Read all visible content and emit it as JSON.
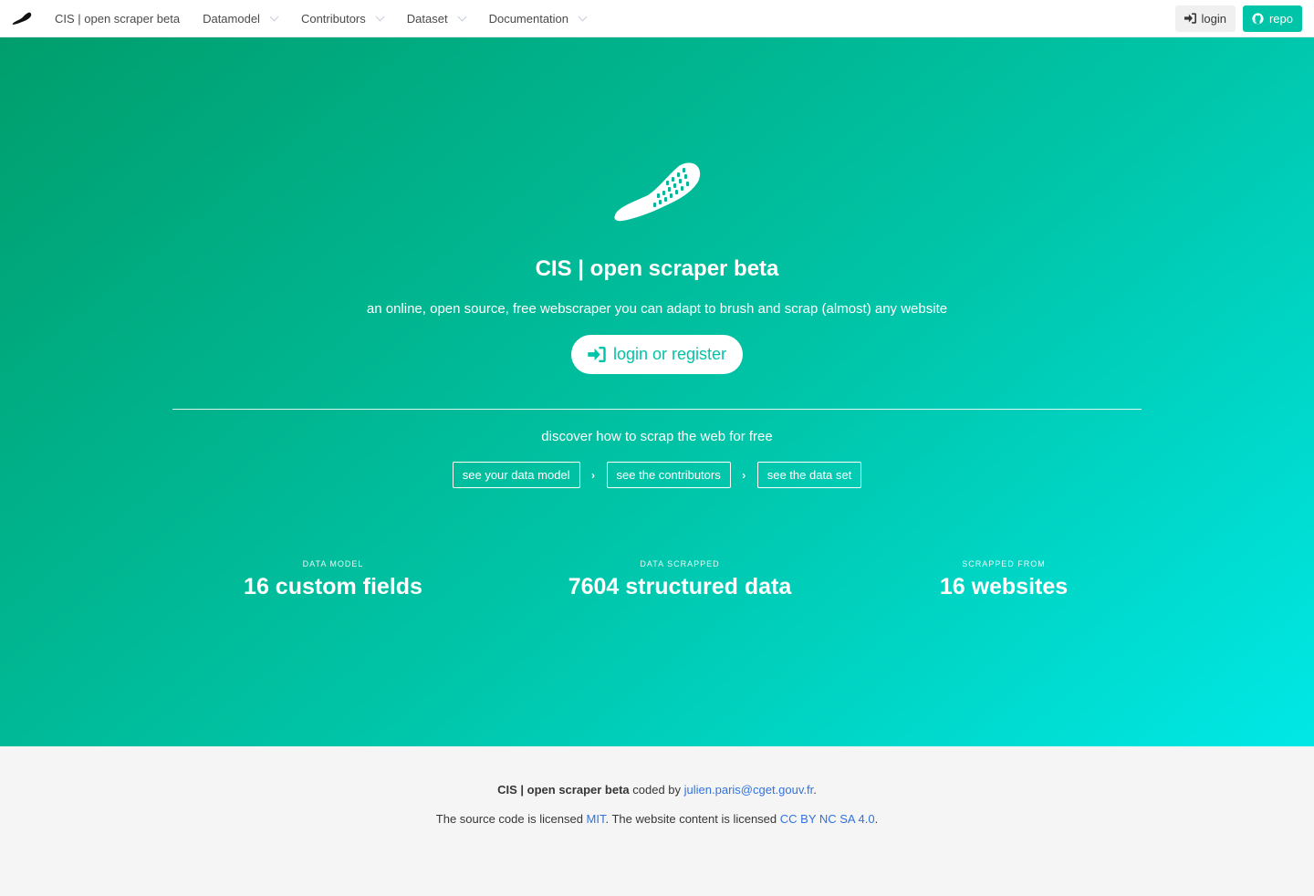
{
  "navbar": {
    "brand": "CIS | open scraper beta",
    "menus": [
      "Datamodel",
      "Contributors",
      "Dataset",
      "Documentation"
    ],
    "login_label": "login",
    "repo_label": "repo"
  },
  "hero": {
    "title": "CIS | open scraper beta",
    "subtitle": "an online, open source, free webscraper you can adapt to brush and scrap (almost) any website",
    "cta_label": "login or register",
    "discover_text": "discover how to scrap the web for free",
    "steps": [
      "see your data model",
      "see the contributors",
      "see the data set"
    ],
    "stats": [
      {
        "label": "DATA MODEL",
        "value": "16 custom fields"
      },
      {
        "label": "DATA SCRAPPED",
        "value": "7604 structured data"
      },
      {
        "label": "SCRAPPED FROM",
        "value": "16 websites"
      }
    ]
  },
  "footer": {
    "brand": "CIS | open scraper beta",
    "coded_by": " coded by ",
    "email": "julien.paris@cget.gouv.fr",
    "period": ".",
    "license_prefix": "The source code is licensed ",
    "license_code": "MIT",
    "license_middle": ". The website content is licensed ",
    "license_content": "CC BY NC SA 4.0",
    "license_end": "."
  },
  "colors": {
    "accent": "#00c4a7",
    "gradient_start": "#009e6c",
    "gradient_end": "#00e8e6",
    "link": "#3273dc"
  },
  "icons": [
    "brush-logo-icon",
    "chevron-down-icon",
    "sign-in-icon",
    "github-icon",
    "chevron-right-icon"
  ]
}
